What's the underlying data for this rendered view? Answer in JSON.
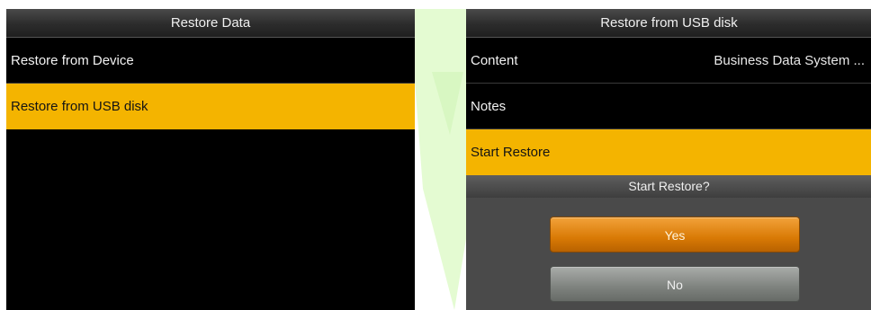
{
  "left_screen": {
    "title": "Restore Data",
    "items": [
      {
        "label": "Restore from Device",
        "selected": false
      },
      {
        "label": "Restore from USB disk",
        "selected": true
      }
    ]
  },
  "right_screen": {
    "title": "Restore from USB disk",
    "items": [
      {
        "label": "Content",
        "value": "Business Data System ...",
        "selected": false
      },
      {
        "label": "Notes",
        "selected": false
      },
      {
        "label": "Start Restore",
        "selected": true
      }
    ],
    "dialog": {
      "title": "Start Restore?",
      "yes_label": "Yes",
      "no_label": "No"
    }
  },
  "colors": {
    "selection": "#f4b400",
    "yes_button": "#e08a10",
    "no_button": "#8a8d8a",
    "background": "#000000"
  }
}
